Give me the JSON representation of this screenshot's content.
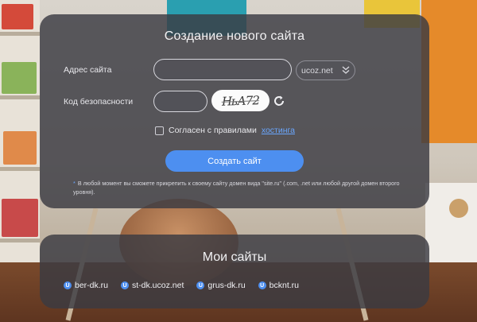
{
  "create": {
    "title": "Создание нового сайта",
    "address_label": "Адрес сайта",
    "address_value": "",
    "domain_selected": "ucoz.net",
    "security_label": "Код безопасности",
    "security_value": "",
    "captcha_text": "НьА72",
    "agree_text": "Согласен с правилами",
    "agree_link": "хостинга",
    "submit_label": "Создать сайт",
    "note": "В любой момент вы сможете прикрепить к своему сайту домен вида \"site.ru\" (.com, .net или любой другой домен второго уровня)."
  },
  "my_sites": {
    "title": "Мои сайты",
    "icon_letter": "U",
    "items": [
      {
        "label": "ber-dk.ru"
      },
      {
        "label": "st-dk.ucoz.net"
      },
      {
        "label": "grus-dk.ru"
      },
      {
        "label": "bcknt.ru"
      }
    ]
  },
  "colors": {
    "accent": "#4d8ff0",
    "link": "#6aa7ff",
    "panel": "#3a3a42"
  },
  "icons": {
    "select_arrow": "chevron-down-icon",
    "refresh": "refresh-icon",
    "site": "ucoz-icon"
  }
}
